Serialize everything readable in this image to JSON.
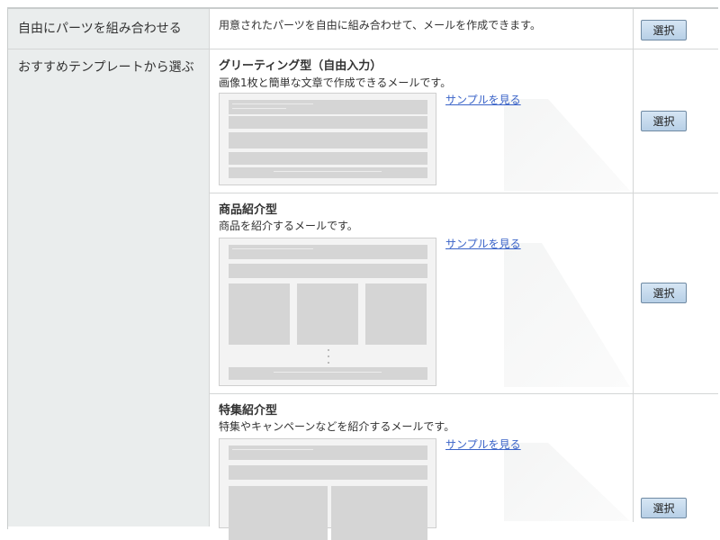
{
  "rows": {
    "free_parts": {
      "heading": "自由にパーツを組み合わせる",
      "description": "用意されたパーツを自由に組み合わせて、メールを作成できます。",
      "select_label": "選択"
    },
    "templates": {
      "heading": "おすすめテンプレートから選ぶ",
      "items": [
        {
          "title": "グリーティング型（自由入力）",
          "description": "画像1枚と簡単な文章で作成できるメールです。",
          "sample_link": "サンプルを見る",
          "select_label": "選択"
        },
        {
          "title": "商品紹介型",
          "description": "商品を紹介するメールです。",
          "sample_link": "サンプルを見る",
          "select_label": "選択"
        },
        {
          "title": "特集紹介型",
          "description": "特集やキャンペーンなどを紹介するメールです。",
          "sample_link": "サンプルを見る",
          "select_label": "選択"
        }
      ]
    }
  }
}
